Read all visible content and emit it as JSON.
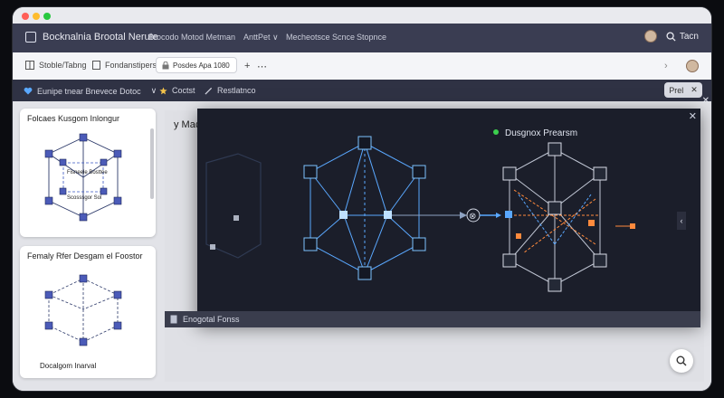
{
  "window": {
    "traffic_lights": [
      "#ff5f57",
      "#febc2e",
      "#28c840"
    ]
  },
  "menubar": {
    "app_title": "Bocknalnia Brootal Nerute",
    "menu_items": [
      "Brocodo Motod Metman",
      "AnttPet ∨",
      "Mecheotsce Scnce",
      "Stopnce"
    ],
    "right_label": "Tacn",
    "search_icon": "search-icon"
  },
  "toolbar": {
    "item1": "Stoble/Tabng",
    "item2": "Fondanstiperst",
    "input_value": "Posdes Apa 1080",
    "add": "+",
    "more": "⋯",
    "chevron": "›"
  },
  "subbar": {
    "favorite": "Eunipe tnear Bnevece Dotoc",
    "chevron": "∨",
    "item2": "Coctst",
    "item3": "Restlatnco",
    "close_label": "Prel",
    "close_x": "✕"
  },
  "cards": [
    {
      "title": "Folcaes Kusgom Inlongur",
      "label1": "Fisneele Bosttee",
      "label2": "Scosssgor Sol"
    },
    {
      "title": "Femaly Rfer Desgam el Foostor",
      "caption": "Docalgom Inarval"
    }
  ],
  "main": {
    "heading": "y Mac"
  },
  "overlay": {
    "heading": "Dusgnox Prearsm",
    "close_x": "✕",
    "close_outer": "✕",
    "arrow_badge": "⊗"
  },
  "footer": {
    "label": "Enogotal Fonss"
  },
  "fab_icon": "search-icon",
  "colors": {
    "accent_blue": "#5aa8ff",
    "accent_orange": "#ff8a3d",
    "accent_green": "#3ccf4e",
    "menubar": "#3a3d52"
  }
}
